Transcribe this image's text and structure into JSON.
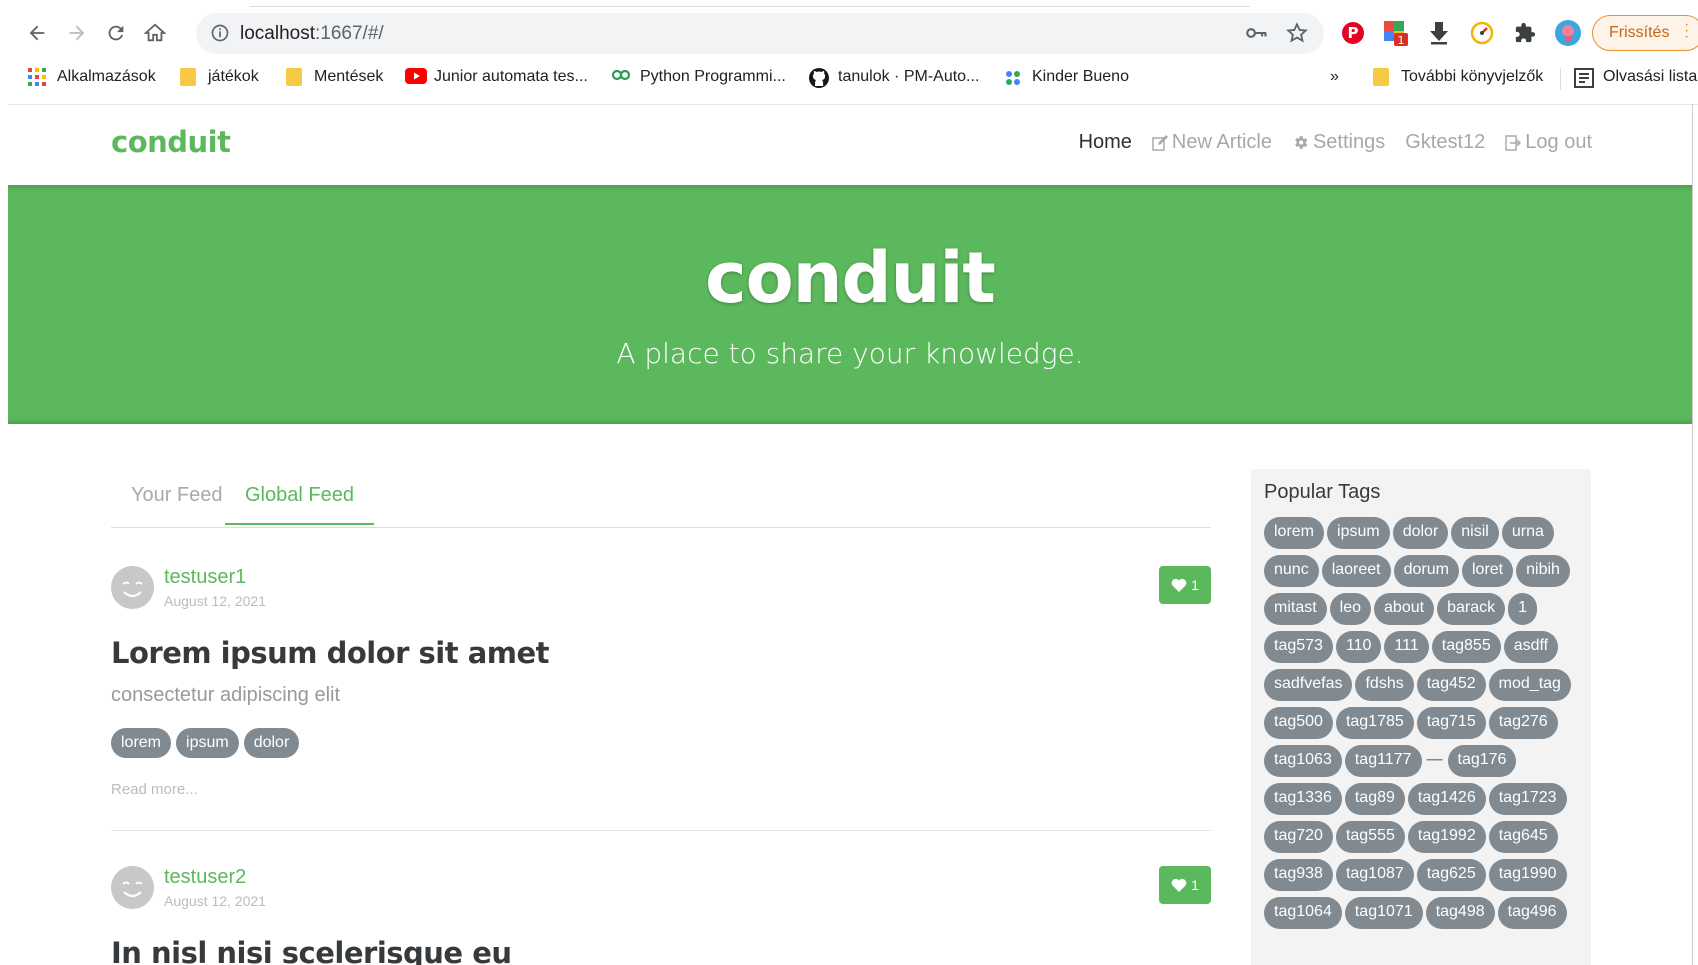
{
  "browser": {
    "url_host": "localhost",
    "url_path": ":1667/#/",
    "update_label": "Frissítés",
    "ext_badge": "1",
    "bookmarks": [
      {
        "label": "Alkalmazások",
        "icon": "apps-grid-icon"
      },
      {
        "label": "játékok",
        "icon": "folder-icon"
      },
      {
        "label": "Mentések",
        "icon": "folder-icon"
      },
      {
        "label": "Junior automata tes...",
        "icon": "youtube-icon"
      },
      {
        "label": "Python Programmi...",
        "icon": "link-icon"
      },
      {
        "label": "tanulok · PM-Auto...",
        "icon": "github-icon"
      },
      {
        "label": "Kinder Bueno",
        "icon": "app-icon"
      }
    ],
    "overflow_label": "»",
    "other_bookmarks": "További könyvjelzők",
    "reading_list": "Olvasási lista"
  },
  "app": {
    "brand": "conduit",
    "nav": {
      "home": "Home",
      "new_article": "New Article",
      "settings": "Settings",
      "user": "Gktest12",
      "logout": "Log out"
    },
    "banner": {
      "title": "conduit",
      "subtitle": "A place to share your knowledge."
    },
    "feed_tabs": {
      "your_feed": "Your Feed",
      "global_feed": "Global Feed"
    },
    "articles": [
      {
        "author": "testuser1",
        "date": "August 12, 2021",
        "likes": "1",
        "title": "Lorem ipsum dolor sit amet",
        "description": "consectetur adipiscing elit",
        "tags": [
          "lorem",
          "ipsum",
          "dolor"
        ],
        "read_more": "Read more..."
      },
      {
        "author": "testuser2",
        "date": "August 12, 2021",
        "likes": "1",
        "title": "In nisl nisi scelerisque eu"
      }
    ],
    "popular_tags_title": "Popular Tags",
    "popular_tags": [
      "lorem",
      "ipsum",
      "dolor",
      "nisil",
      "urna",
      "nunc",
      "laoreet",
      "dorum",
      "loret",
      "nibih",
      "mitast",
      "leo",
      "about",
      "barack",
      "1",
      "tag573",
      "110",
      "111",
      "tag855",
      "asdff",
      "sadfvefas",
      "fdshs",
      "tag452",
      "mod_tag",
      "tag500",
      "tag1785",
      "tag715",
      "tag276",
      "tag1063",
      "tag1177",
      "—",
      "tag176",
      "tag1336",
      "tag89",
      "tag1426",
      "tag1723",
      "tag720",
      "tag555",
      "tag1992",
      "tag645",
      "tag938",
      "tag1087",
      "tag625",
      "tag1990",
      "tag1064",
      "tag1071",
      "tag498",
      "tag496"
    ],
    "colors": {
      "brand_green": "#5cb85c",
      "tag_gray": "#818a91"
    }
  }
}
